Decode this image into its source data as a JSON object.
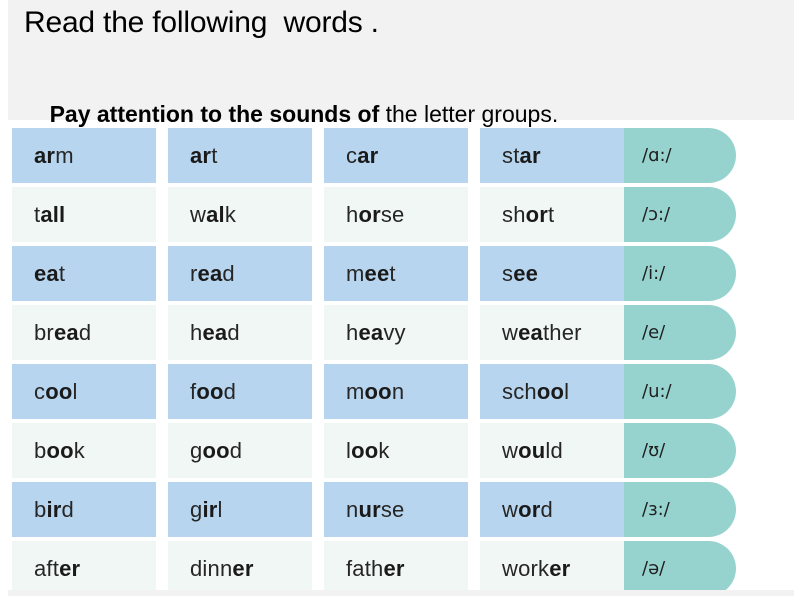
{
  "header": {
    "line1": "Read the following  words .",
    "line2_bold": "Pay attention to the sounds of",
    "line2_rest": " the letter groups."
  },
  "table": {
    "rows": [
      {
        "shaded": true,
        "ipa": "/ɑ:/",
        "words": [
          {
            "pre": "",
            "bold": "ar",
            "post": "m"
          },
          {
            "pre": "",
            "bold": "ar",
            "post": "t"
          },
          {
            "pre": "c",
            "bold": "ar",
            "post": ""
          },
          {
            "pre": "st",
            "bold": "ar",
            "post": ""
          }
        ]
      },
      {
        "shaded": false,
        "ipa": "/ɔ:/",
        "words": [
          {
            "pre": "t",
            "bold": "all",
            "post": ""
          },
          {
            "pre": "w",
            "bold": "al",
            "post": "k"
          },
          {
            "pre": "h",
            "bold": "or",
            "post": "se"
          },
          {
            "pre": "sh",
            "bold": "or",
            "post": "t"
          }
        ]
      },
      {
        "shaded": true,
        "ipa": "/i:/",
        "words": [
          {
            "pre": "",
            "bold": "ea",
            "post": "t"
          },
          {
            "pre": "r",
            "bold": "ea",
            "post": "d"
          },
          {
            "pre": "m",
            "bold": "ee",
            "post": "t"
          },
          {
            "pre": "s",
            "bold": "ee",
            "post": ""
          }
        ]
      },
      {
        "shaded": false,
        "ipa": "/e/",
        "words": [
          {
            "pre": "br",
            "bold": "ea",
            "post": "d"
          },
          {
            "pre": "h",
            "bold": "ea",
            "post": "d"
          },
          {
            "pre": "h",
            "bold": "ea",
            "post": "vy"
          },
          {
            "pre": "w",
            "bold": "ea",
            "post": "ther"
          }
        ]
      },
      {
        "shaded": true,
        "ipa": "/u:/",
        "words": [
          {
            "pre": "c",
            "bold": "oo",
            "post": "l"
          },
          {
            "pre": "f",
            "bold": "oo",
            "post": "d"
          },
          {
            "pre": "m",
            "bold": "oo",
            "post": "n"
          },
          {
            "pre": "sch",
            "bold": "oo",
            "post": "l"
          }
        ]
      },
      {
        "shaded": false,
        "ipa": "/ʊ/",
        "words": [
          {
            "pre": "b",
            "bold": "oo",
            "post": "k"
          },
          {
            "pre": "g",
            "bold": "oo",
            "post": "d"
          },
          {
            "pre": "l",
            "bold": "oo",
            "post": "k"
          },
          {
            "pre": "w",
            "bold": "ou",
            "post": "ld"
          }
        ]
      },
      {
        "shaded": true,
        "ipa": "/ɜ:/",
        "words": [
          {
            "pre": "b",
            "bold": "ir",
            "post": "d"
          },
          {
            "pre": "g",
            "bold": "ir",
            "post": "l"
          },
          {
            "pre": "n",
            "bold": "ur",
            "post": "se"
          },
          {
            "pre": "w",
            "bold": "or",
            "post": "d"
          }
        ]
      },
      {
        "shaded": false,
        "ipa": "/ə/",
        "words": [
          {
            "pre": "aft",
            "bold": "er",
            "post": ""
          },
          {
            "pre": "dinn",
            "bold": "er",
            "post": ""
          },
          {
            "pre": "fath",
            "bold": "er",
            "post": ""
          },
          {
            "pre": "work",
            "bold": "er",
            "post": ""
          }
        ]
      }
    ]
  },
  "colors": {
    "header_band": "#f2f2f2",
    "row_shaded": "#b7d5ee",
    "row_plain": "#f1f7f5",
    "ipa_pill": "#97d3ce",
    "text": "#262626"
  }
}
